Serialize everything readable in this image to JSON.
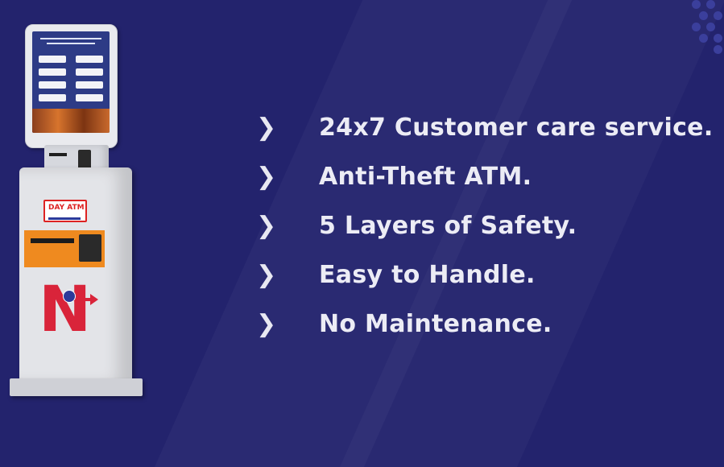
{
  "features": [
    {
      "text": "24x7 Customer care service.",
      "icon": "chevron-right-double-icon"
    },
    {
      "text": "Anti-Theft ATM.",
      "icon": "chevron-right-double-icon"
    },
    {
      "text": "5 Layers of Safety.",
      "icon": "chevron-right-double-icon"
    },
    {
      "text": "Easy to Handle.",
      "icon": "chevron-right-double-icon"
    },
    {
      "text": "No Maintenance.",
      "icon": "chevron-right-double-icon"
    }
  ],
  "colors": {
    "background": "#23236d",
    "text": "#ececf5",
    "kiosk_body": "#e3e4e8",
    "kiosk_accent": "#ef8a1f",
    "brand_red": "#d9243a"
  },
  "kiosk": {
    "logo_text": "DAY ATM",
    "mark_text": "N"
  }
}
